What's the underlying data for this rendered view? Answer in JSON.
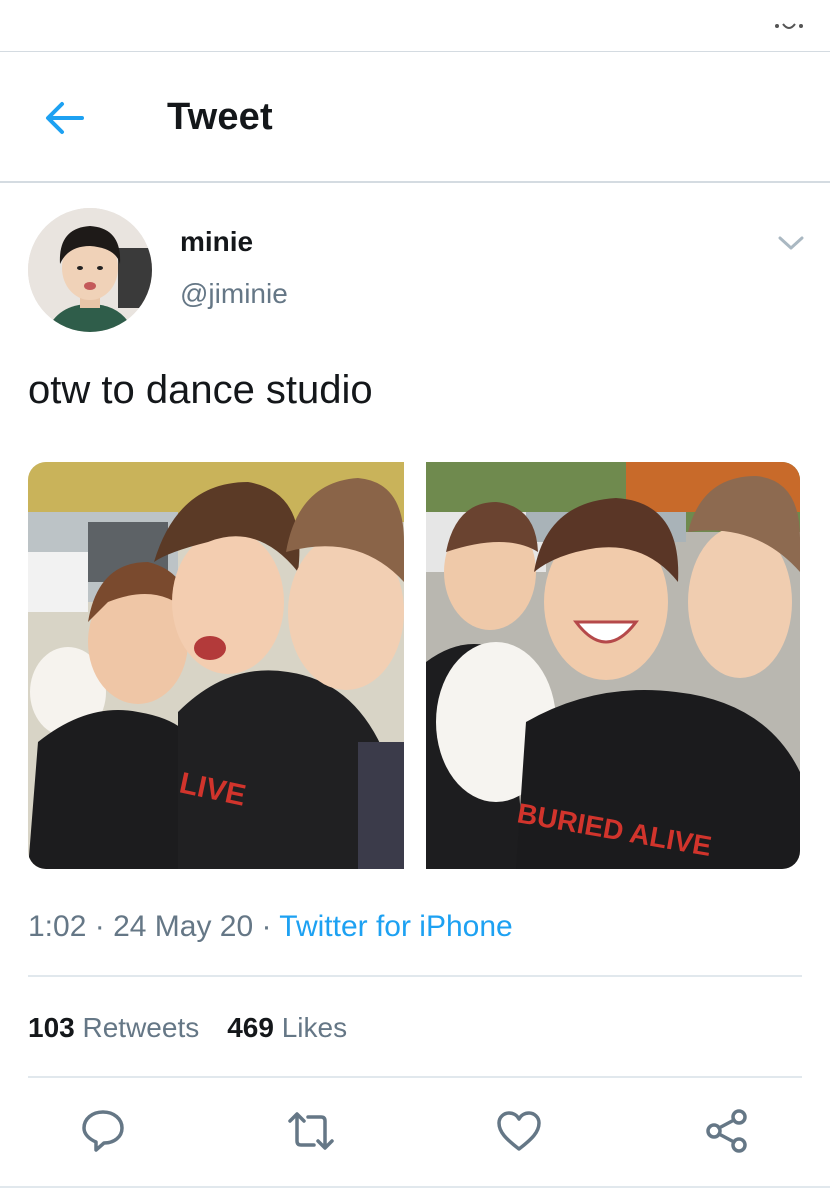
{
  "header": {
    "title": "Tweet",
    "back_icon": "arrow-left-icon"
  },
  "tweet": {
    "display_name": "minie",
    "handle": "@jiminie",
    "text": "otw to dance studio",
    "time": "1:02",
    "date": "24 May 20",
    "separator": " · ",
    "source": "Twitter for iPhone",
    "media_count": 2
  },
  "stats": {
    "retweets_count": "103",
    "retweets_label": "Retweets",
    "likes_count": "469",
    "likes_label": "Likes"
  },
  "actions": {
    "reply_icon": "reply-icon",
    "retweet_icon": "retweet-icon",
    "like_icon": "heart-icon",
    "share_icon": "share-icon"
  },
  "colors": {
    "accent": "#1da1f2",
    "text_primary": "#14171a",
    "text_secondary": "#657786",
    "divider": "#e1e8ed"
  }
}
